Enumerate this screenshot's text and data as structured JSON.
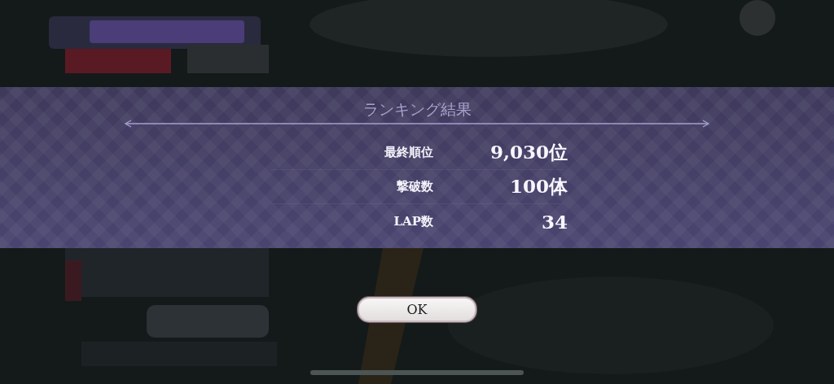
{
  "dialog": {
    "title": "ランキング結果",
    "rows": [
      {
        "label": "最終順位",
        "value": "9,030位"
      },
      {
        "label": "撃破数",
        "value": "100体"
      },
      {
        "label": "LAP数",
        "value": "34"
      }
    ],
    "button": "OK"
  }
}
